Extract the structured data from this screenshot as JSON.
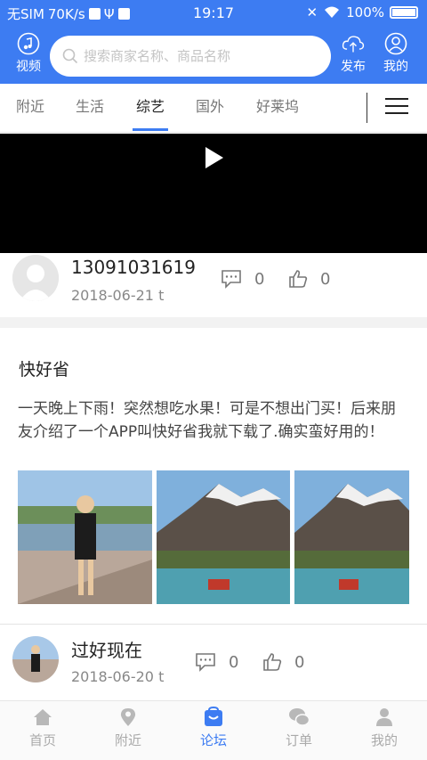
{
  "status_bar": {
    "carrier": "无SIM",
    "speed": "70K/s",
    "time": "19:17",
    "battery": "100%"
  },
  "header": {
    "video_label": "视频",
    "search_placeholder": "搜索商家名称、商品名称",
    "publish_label": "发布",
    "mine_label": "我的"
  },
  "tabs": [
    {
      "label": "附近",
      "active": false
    },
    {
      "label": "生活",
      "active": false
    },
    {
      "label": "综艺",
      "active": true
    },
    {
      "label": "国外",
      "active": false
    },
    {
      "label": "好莱坞",
      "active": false
    }
  ],
  "post1": {
    "author": "13091031619",
    "date": "2018-06-21 t",
    "comments": "0",
    "likes": "0"
  },
  "post2": {
    "title": "快好省",
    "body": "一天晚上下雨！突然想吃水果！可是不想出门买！后来朋友介绍了一个APP叫快好省我就下载了.确实蛮好用的！",
    "author": "过好现在",
    "date": "2018-06-20 t",
    "comments": "0",
    "likes": "0"
  },
  "bottom_nav": [
    {
      "label": "首页",
      "icon": "home-icon",
      "active": false
    },
    {
      "label": "附近",
      "icon": "location-icon",
      "active": false
    },
    {
      "label": "论坛",
      "icon": "forum-icon",
      "active": true
    },
    {
      "label": "订单",
      "icon": "order-icon",
      "active": false
    },
    {
      "label": "我的",
      "icon": "user-icon",
      "active": false
    }
  ],
  "colors": {
    "primary": "#3d7cf2",
    "video_bg": "#000000",
    "tab_active_underline": "#3d7cf2"
  }
}
